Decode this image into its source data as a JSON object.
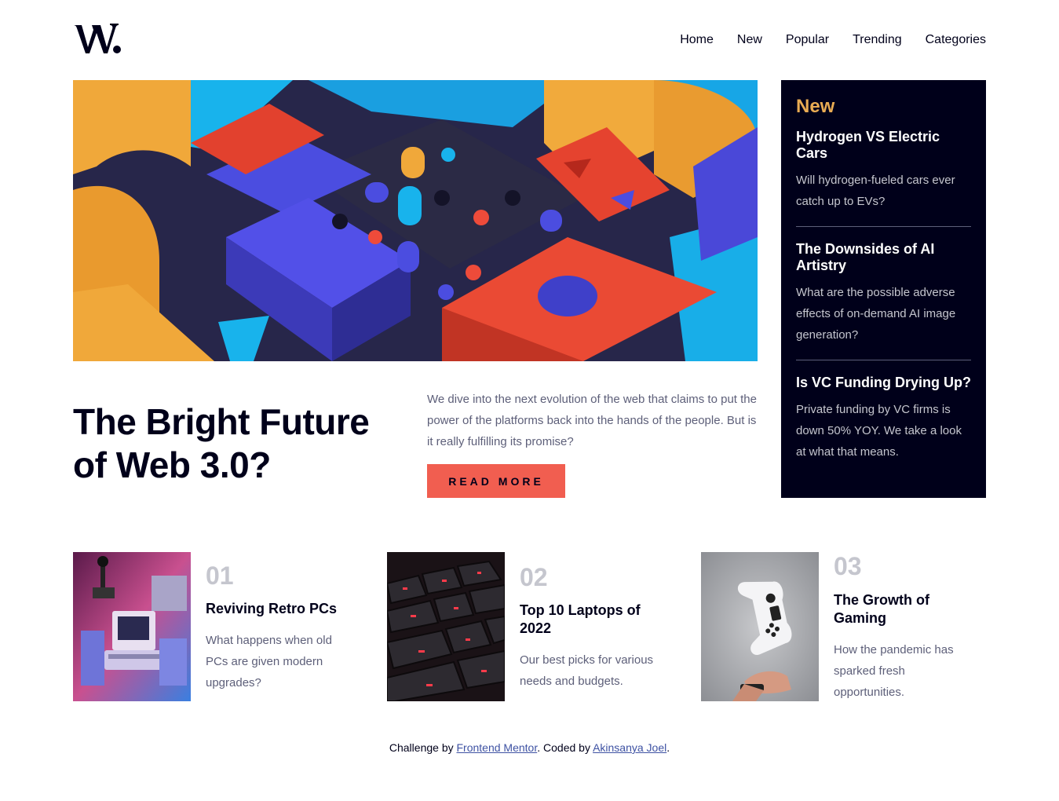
{
  "brand": {
    "logo_alt": "W."
  },
  "nav": {
    "items": [
      {
        "label": "Home"
      },
      {
        "label": "New"
      },
      {
        "label": "Popular"
      },
      {
        "label": "Trending"
      },
      {
        "label": "Categories"
      }
    ]
  },
  "hero": {
    "title": "The Bright Future of Web 3.0?",
    "description": "We dive into the next evolution of the web that claims to put the power of the platforms back into the hands of the people. But is it really fulfilling its promise?",
    "button_label": "READ MORE"
  },
  "new_panel": {
    "heading": "New",
    "items": [
      {
        "title": "Hydrogen VS Electric Cars",
        "description": "Will hydrogen-fueled cars ever catch up to EVs?"
      },
      {
        "title": "The Downsides of AI Artistry",
        "description": "What are the possible adverse effects of on-demand AI image generation?"
      },
      {
        "title": "Is VC Funding Drying Up?",
        "description": "Private funding by VC firms is down 50% YOY. We take a look at what that means."
      }
    ]
  },
  "cards": [
    {
      "number": "01",
      "title": "Reviving Retro PCs",
      "description": "What happens when old PCs are given modern upgrades?"
    },
    {
      "number": "02",
      "title": "Top 10 Laptops of 2022",
      "description": "Our best picks for various needs and budgets."
    },
    {
      "number": "03",
      "title": "The Growth of Gaming",
      "description": "How the pandemic has sparked fresh opportunities."
    }
  ],
  "footer": {
    "prefix": "Challenge by ",
    "link1": "Frontend Mentor",
    "middle": ". Coded by ",
    "link2": "Akinsanya Joel",
    "suffix": "."
  },
  "colors": {
    "accent_red": "#f15e50",
    "accent_orange": "#e9ab53",
    "dark_navy": "#00001a",
    "grayish_blue": "#5d5f79",
    "grayish_light": "#c5c6ce"
  }
}
